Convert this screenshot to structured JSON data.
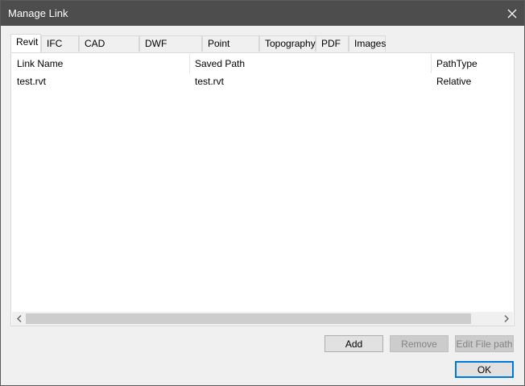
{
  "window": {
    "title": "Manage Link"
  },
  "tabs": [
    {
      "label": "Revit",
      "active": true
    },
    {
      "label": "IFC"
    },
    {
      "label": "CAD Formats"
    },
    {
      "label": "DWF Markups"
    },
    {
      "label": "Point Clouds"
    },
    {
      "label": "Topography"
    },
    {
      "label": "PDF"
    },
    {
      "label": "Images"
    }
  ],
  "table": {
    "columns": [
      "Link Name",
      "Saved Path",
      "PathType"
    ],
    "rows": [
      [
        "test.rvt",
        "test.rvt",
        "Relative"
      ]
    ]
  },
  "buttons": {
    "add": "Add",
    "remove": "Remove",
    "edit_file_path": "Edit File path",
    "ok": "OK"
  },
  "colors": {
    "titlebar": "#4d4d4d",
    "focus_border": "#0078d7"
  },
  "icons": {
    "close": "close-icon",
    "scroll_left": "chevron-left-icon",
    "scroll_right": "chevron-right-icon"
  }
}
